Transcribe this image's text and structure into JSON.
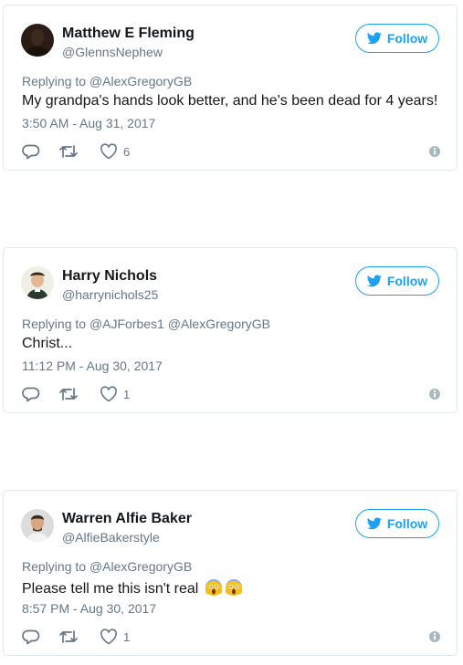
{
  "colors": {
    "accent": "#1da1f2",
    "text": "#14171a",
    "secondary": "#657786",
    "border": "#e1e8ed"
  },
  "follow_label": "Follow",
  "tweets": [
    {
      "author": "Matthew E Fleming",
      "handle": "@GlennsNephew",
      "replying_prefix": "Replying to",
      "replying_to": [
        "@AlexGregoryGB"
      ],
      "text": "My grandpa's hands look better, and he's been dead for 4 years!",
      "timestamp": "3:50 AM - Aug 31, 2017",
      "likes": "6",
      "emoji": []
    },
    {
      "author": "Harry Nichols",
      "handle": "@harrynichols25",
      "replying_prefix": "Replying to",
      "replying_to": [
        "@AJForbes1",
        "@AlexGregoryGB"
      ],
      "text": "Christ...",
      "timestamp": "11:12 PM - Aug 30, 2017",
      "likes": "1",
      "emoji": []
    },
    {
      "author": "Warren Alfie Baker",
      "handle": "@AlfieBakerstyle",
      "replying_prefix": "Replying to",
      "replying_to": [
        "@AlexGregoryGB"
      ],
      "text": "Please tell me this isn't real",
      "timestamp": "8:57 PM - Aug 30, 2017",
      "likes": "1",
      "emoji": [
        "screaming-face-emoji",
        "screaming-face-emoji"
      ]
    }
  ]
}
